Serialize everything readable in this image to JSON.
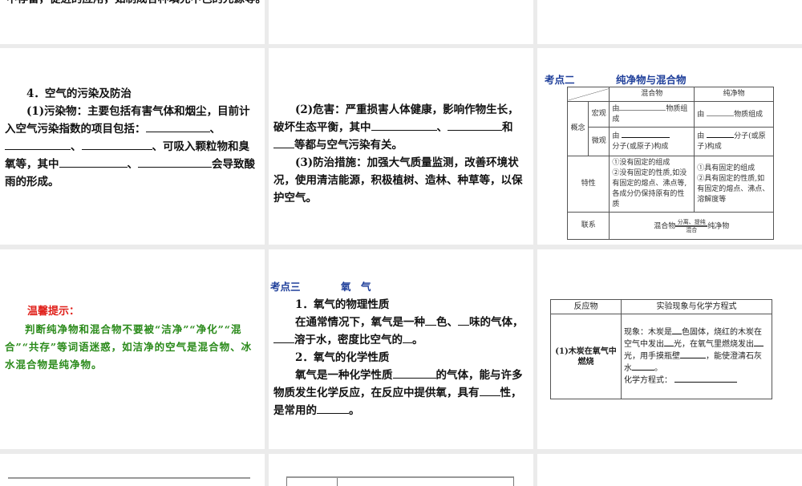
{
  "slide1": {
    "cut_text": "中存留，促进的应用，如制成各种填充中色的光源等。"
  },
  "slide4": {
    "heading": "4．空气的污染及防治",
    "p1a": "(1)污染物：主要包括有害气体和烟尘，目前计入空气污染指数的项目包括：",
    "sep": "、",
    "p1b": "、可吸入颗粒物和臭氧等，其",
    "p1c": "中",
    "p1d": "会导致酸雨的形成。"
  },
  "slide5": {
    "p2a": "(2)危害：严重损害人体健康，影响作物生长，破坏生态平衡，其中",
    "sep": "、",
    "and": "和",
    "p2b": "等都与空气污染有关。",
    "p3": "(3)防治措施：加强大气质量监测，改善环境状况，使用清洁能源，积极植树、造林、种草等，以保护空气。"
  },
  "slide6": {
    "label": "考点二",
    "title": "纯净物与混合物",
    "table": {
      "col_mix": "混合物",
      "col_pure": "纯净物",
      "concept": "概念",
      "macro": "宏观",
      "micro": "微观",
      "you": "由",
      "macro_tail": "物质组成",
      "micro_mix_tail": "分子(或原子)构成",
      "micro_pure_a": "分子(或原",
      "micro_pure_b": "子)构成",
      "trait": "特性",
      "mix_traits": [
        "①没有固定的组成",
        "②没有固定的性质,如没有固定的熔点、沸点等,各成分仍保持原有的性质"
      ],
      "pure_traits": [
        "①具有固定的组成",
        "②具有固定的性质,如有固定的熔点、沸点、溶解度等"
      ],
      "relation": "联系",
      "rel_left": "混合物",
      "rel_top": "分离、提纯",
      "rel_bottom": "混合",
      "rel_right": "纯净物"
    }
  },
  "slide7": {
    "tip_title": "温馨提示：",
    "tip_body": "判断纯净物和混合物不要被“洁净”“净化”“混合”“共存”等词语迷惑，如洁净的空气是混合物、冰水混合物是纯净物。"
  },
  "slide8": {
    "label": "考点三",
    "title": "氧　气",
    "h1": "1．氧气的物理性质",
    "p1a": "在通常情况下，氧气是一种",
    "p1b": "色、",
    "p1c": "味的气体，",
    "p1d": "溶于水，密度比空气的",
    "p1e": "。",
    "h2": "2．氧气的化学性质",
    "p2a": "氧气是一种化学性质",
    "p2b": "的气体，能与许多物质发生化学反应，在反应中提供氧，具有",
    "p2c": "性，是常用的",
    "p2d": "。"
  },
  "slide9": {
    "col1": "反应物",
    "col2": "实验现象与化学方程式",
    "reactant": "(1)木炭在氧气中燃烧",
    "ph_a": "现象：木炭是",
    "ph_b": "色固体，烧红的木炭在空气中发出",
    "ph_c": "光，在氧气里燃烧发出",
    "ph_d": "光，用手摸瓶壁",
    "ph_e": "，能使澄清石灰水",
    "ph_f": "。",
    "eq": "化学方程式："
  }
}
